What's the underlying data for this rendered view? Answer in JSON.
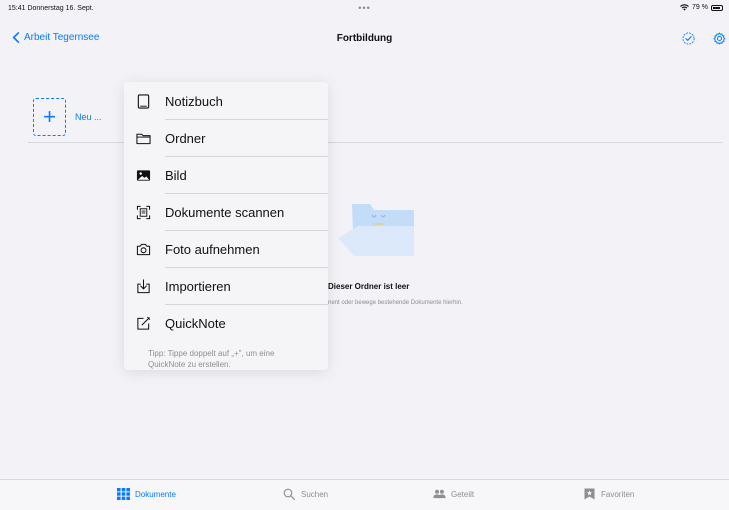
{
  "status": {
    "time": "15:41  Donnerstag 16. Sept.",
    "dots": "•••",
    "battery": "79 %"
  },
  "nav": {
    "back_label": "Arbeit Tegernsee",
    "title": "Fortbildung"
  },
  "new_tile": {
    "plus": "+",
    "label": "Neu ..."
  },
  "empty": {
    "title": "Dieser Ordner ist leer",
    "subtitle": "nent oder bewege bestehende Dokumente hierhin."
  },
  "menu": {
    "items": [
      {
        "label": "Notizbuch",
        "icon": "notebook-icon"
      },
      {
        "label": "Ordner",
        "icon": "folder-icon"
      },
      {
        "label": "Bild",
        "icon": "image-icon"
      },
      {
        "label": "Dokumente scannen",
        "icon": "scan-icon"
      },
      {
        "label": "Foto aufnehmen",
        "icon": "camera-icon"
      },
      {
        "label": "Importieren",
        "icon": "import-icon"
      },
      {
        "label": "QuickNote",
        "icon": "quicknote-icon"
      }
    ],
    "tip_line1": "Tipp: Tippe doppelt auf „+\", um eine",
    "tip_line2": "QuickNote zu erstellen."
  },
  "tabs": [
    {
      "label": "Dokumente",
      "icon": "grid-icon",
      "active": true
    },
    {
      "label": "Suchen",
      "icon": "search-icon",
      "active": false
    },
    {
      "label": "Geteilt",
      "icon": "people-icon",
      "active": false
    },
    {
      "label": "Favoriten",
      "icon": "bookmark-icon",
      "active": false
    }
  ],
  "colors": {
    "accent": "#0a7aff",
    "background": "#f2f2f7",
    "muted": "#8e8e93"
  }
}
